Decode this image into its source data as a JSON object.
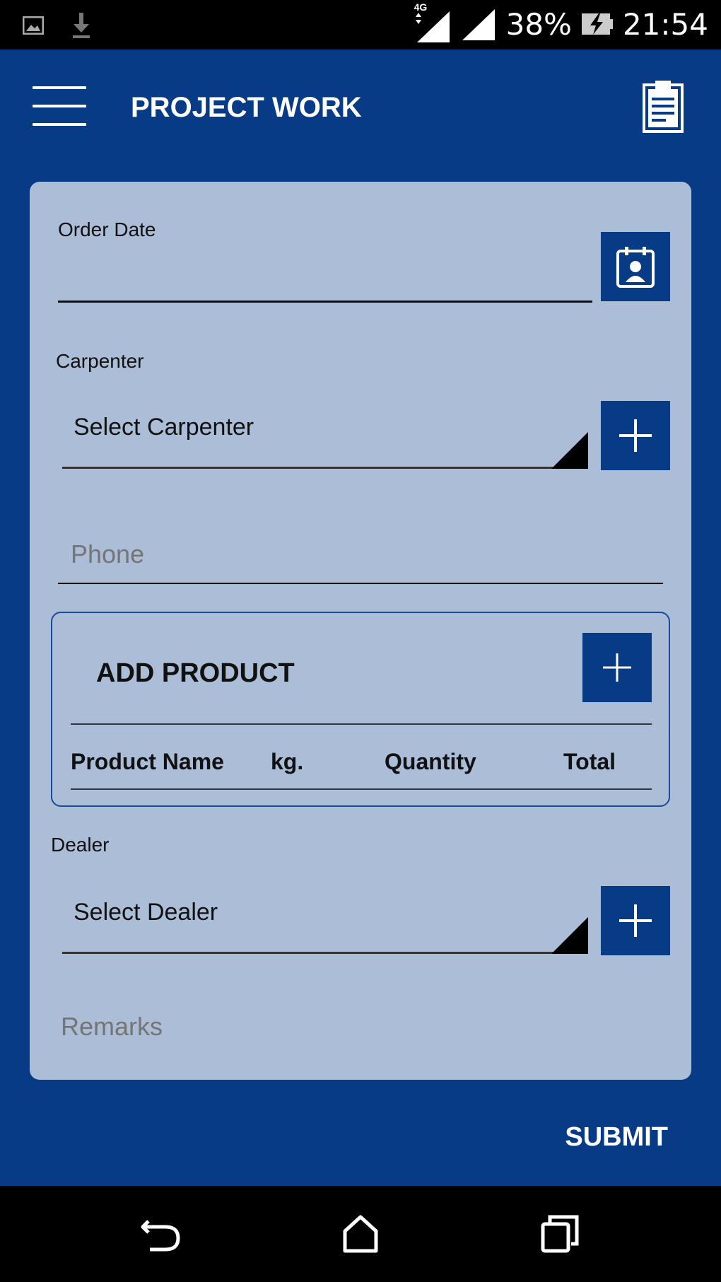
{
  "status_bar": {
    "network_type": "4G",
    "battery_percent": "38%",
    "time": "21:54"
  },
  "app_bar": {
    "title": "PROJECT WORK"
  },
  "form": {
    "order_date": {
      "label": "Order Date",
      "value": ""
    },
    "carpenter": {
      "label": "Carpenter",
      "selected": "Select Carpenter"
    },
    "phone": {
      "placeholder": "Phone",
      "value": ""
    },
    "product_section": {
      "title": "ADD PRODUCT",
      "columns": [
        "Product Name",
        "kg.",
        "Quantity",
        "Total"
      ],
      "rows": []
    },
    "dealer": {
      "label": "Dealer",
      "selected": "Select Dealer"
    },
    "remarks": {
      "placeholder": "Remarks",
      "value": ""
    }
  },
  "actions": {
    "submit_label": "SUBMIT"
  },
  "colors": {
    "primary": "#083b86",
    "card_background": "#acbdd7",
    "status_bar": "#000000"
  },
  "icons": {
    "menu": "hamburger-icon",
    "clipboard": "clipboard-icon",
    "calendar": "calendar-icon",
    "add": "plus-icon",
    "back": "back-icon",
    "home": "home-icon",
    "recents": "recents-icon"
  }
}
